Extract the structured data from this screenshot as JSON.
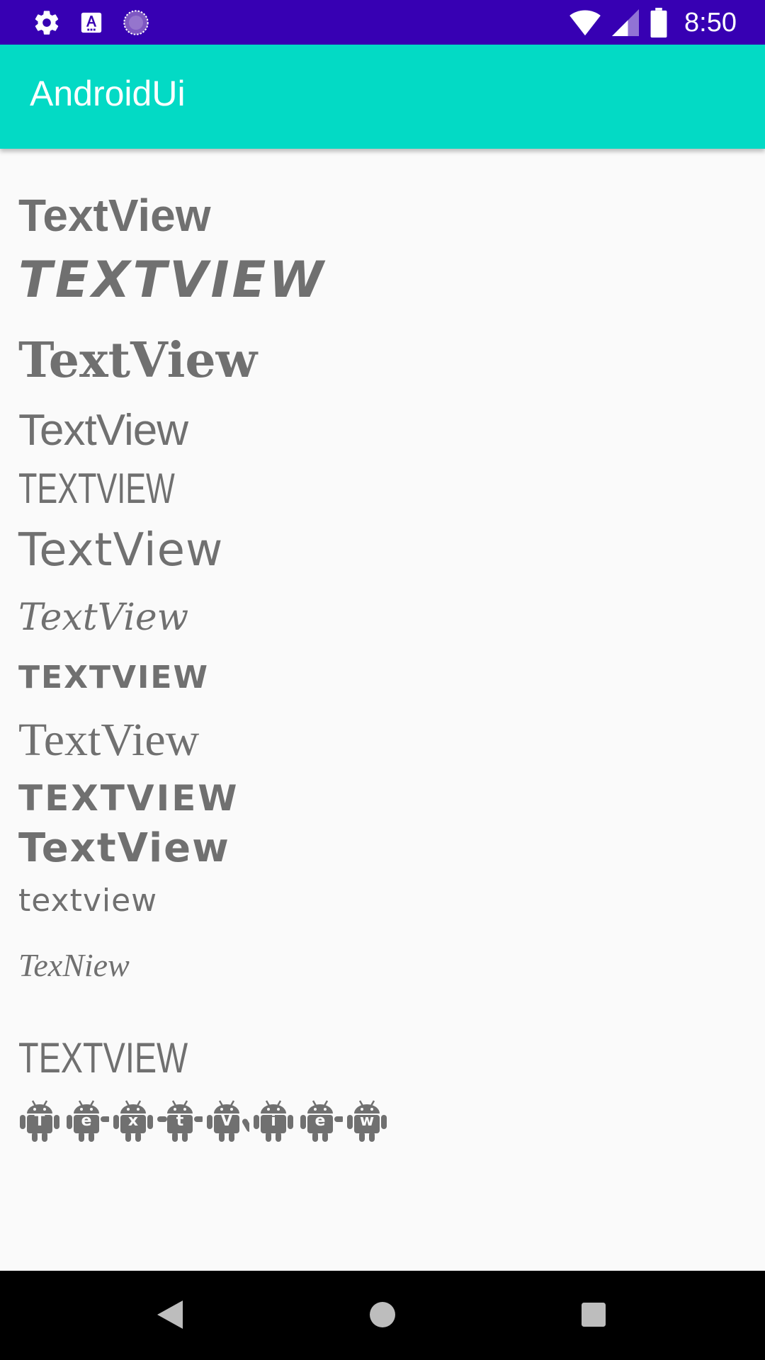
{
  "status_bar": {
    "time": "8:50",
    "icons": [
      "settings-icon",
      "accessibility-font-icon",
      "loading-circle-icon",
      "wifi-icon",
      "signal-icon",
      "battery-icon"
    ]
  },
  "app_bar": {
    "title": "AndroidUi"
  },
  "text_views": [
    "TextView",
    "TEXTVIEW",
    "TextView",
    "TextView",
    "TEXTVIEW",
    "TextView",
    "TextView",
    "TEXTVIEW",
    "TextView",
    "TEXTVIEW",
    "TextView",
    "textview",
    "TexNiew",
    "TEXTVIEW"
  ],
  "android_letters": [
    "T",
    "e",
    "x",
    "t",
    "V",
    "i",
    "e",
    "w"
  ],
  "colors": {
    "status_bar": "#3700b3",
    "app_bar": "#03dac5",
    "text": "#707070",
    "background": "#fafafa",
    "nav_bar": "#000000"
  },
  "nav_bar": {
    "icons": [
      "back-icon",
      "home-icon",
      "recents-icon"
    ]
  }
}
